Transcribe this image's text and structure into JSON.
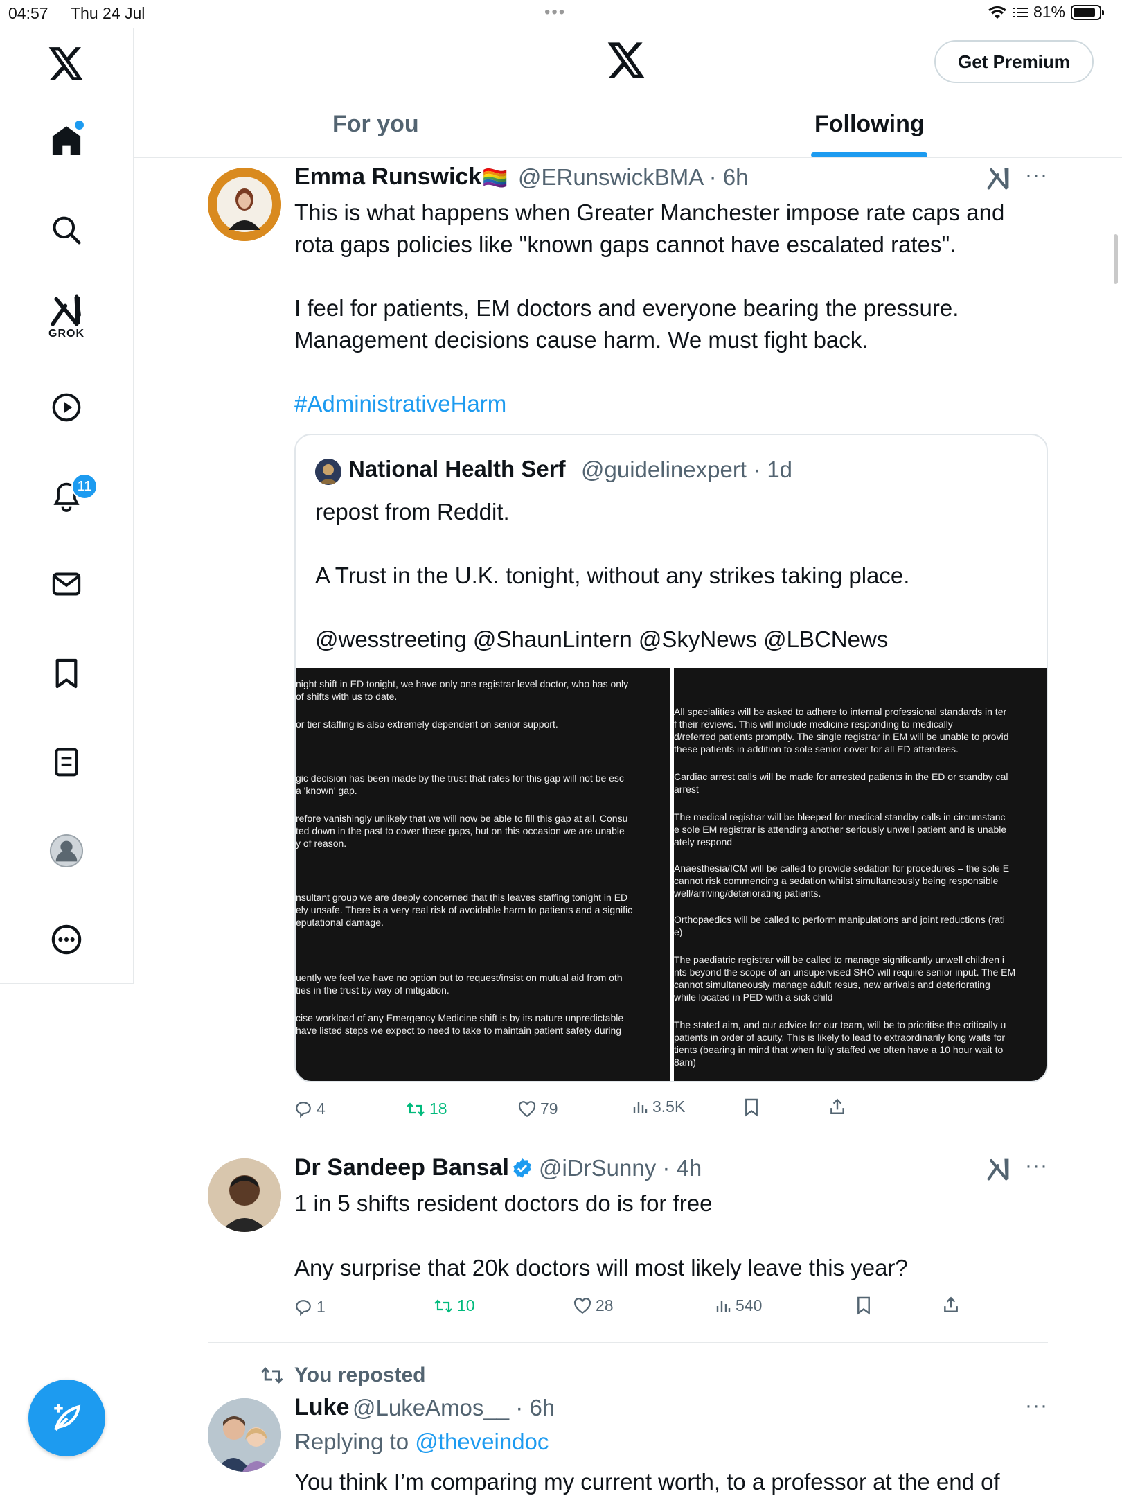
{
  "status_bar": {
    "time": "04:57",
    "date": "Thu 24 Jul",
    "battery": "81%"
  },
  "sidebar": {
    "items": [
      {
        "icon": "x-logo-icon"
      },
      {
        "icon": "home-icon"
      },
      {
        "icon": "search-icon"
      },
      {
        "icon": "grok-icon",
        "label": "GROK"
      },
      {
        "icon": "play-icon"
      },
      {
        "icon": "bell-icon",
        "badge": "11"
      },
      {
        "icon": "mail-icon"
      },
      {
        "icon": "bookmark-icon"
      },
      {
        "icon": "list-icon"
      },
      {
        "icon": "profile-icon"
      },
      {
        "icon": "more-icon"
      }
    ],
    "compose_icon": "compose-icon"
  },
  "header": {
    "premium_label": "Get Premium",
    "tabs": [
      {
        "label": "For you"
      },
      {
        "label": "Following"
      }
    ]
  },
  "posts": [
    {
      "name": "Emma Runswick",
      "flag": "🏳️‍🌈",
      "handle": "@ERunswickBMA",
      "time": "6h",
      "lines": [
        "This is what happens when Greater Manchester impose rate caps and",
        "rota gaps policies like \"known gaps cannot have escalated rates\".",
        "I feel for patients, EM doctors and everyone bearing the pressure.",
        "Management decisions cause harm. We must fight back."
      ],
      "hashtag": "#AdministrativeHarm",
      "quote": {
        "name": "National Health Serf",
        "handle": "@guidelinexpert",
        "time": "1d",
        "lines": [
          "repost from Reddit.",
          "A Trust in the U.K. tonight, without any strikes taking place.",
          "@wesstreeting @ShaunLintern @SkyNews @LBCNews"
        ],
        "image_left": [
          "night shift in ED tonight, we have only one registrar level doctor, who has only",
          " of shifts with us to date.",
          "or tier staffing is also  extremely dependent on senior support.",
          "gic decision has been made by the trust that rates for this gap will not be esc",
          "a 'known' gap.",
          "refore vanishingly unlikely that we will now be able to fill this gap at all. Consu",
          "ted down in the past to cover these gaps, but on this occasion we are unable",
          "y of reason.",
          "nsultant group we are deeply concerned that this leaves staffing tonight in ED",
          "ely unsafe. There is a very real risk of avoidable harm to patients and a signific",
          "eputational damage.",
          "uently we feel we have no option but to request/insist on mutual aid from oth",
          "ties in the trust by way of mitigation.",
          "cise workload of any Emergency Medicine shift is by its nature unpredictable",
          " have listed steps we expect to need to take to maintain patient safety during"
        ],
        "image_right": [
          "All specialities will be asked to adhere to internal professional standards in ter",
          "f their reviews. This will include medicine responding to medically",
          "d/referred patients promptly. The single registrar in EM will be unable to provid",
          " these patients in addition to sole senior cover for all ED attendees.",
          "Cardiac arrest calls will be made for arrested patients in the ED or standby cal",
          "arrest",
          "The medical registrar will be bleeped for medical standby calls in circumstanc",
          "e sole EM registrar is attending another seriously unwell patient and is unable",
          "ately respond",
          "Anaesthesia/ICM will be called to provide sedation for procedures – the sole E",
          " cannot risk commencing a sedation whilst simultaneously being responsible",
          "well/arriving/deteriorating patients.",
          "Orthopaedics will be called to perform manipulations and joint reductions (rati",
          "e)",
          "The paediatric registrar will be called to manage significantly unwell children i",
          "nts beyond the scope of an unsupervised SHO will require senior input. The EM",
          " cannot simultaneously manage adult resus, new arrivals and deteriorating",
          " while located in PED with a sick child",
          "The stated aim, and our advice for our team, will be to prioritise the critically u",
          "patients in order of acuity. This is likely to lead to extraordinarily long waits for",
          "tients (bearing in mind that when fully staffed we often have a 10 hour wait to",
          "8am)"
        ]
      },
      "stats": {
        "replies": "4",
        "reposts": "18",
        "likes": "79",
        "views": "3.5K"
      }
    },
    {
      "name": "Dr Sandeep Bansal",
      "verified": true,
      "handle": "@iDrSunny",
      "time": "4h",
      "lines": [
        "1 in 5 shifts resident doctors do is for free",
        "Any surprise that 20k doctors will most likely leave this year?"
      ],
      "stats": {
        "replies": "1",
        "reposts": "10",
        "likes": "28",
        "views": "540"
      }
    },
    {
      "repost_label": "You reposted",
      "name": "Luke",
      "handle": "@LukeAmos__",
      "time": "6h",
      "replying_prefix": "Replying to",
      "replying_to": "@theveindoc",
      "lines": [
        "You think I’m comparing my current worth, to a professor at the end of"
      ]
    }
  ],
  "colors": {
    "accent": "#1d9bf0",
    "repost_green": "#00ba7c",
    "muted": "#536471"
  }
}
